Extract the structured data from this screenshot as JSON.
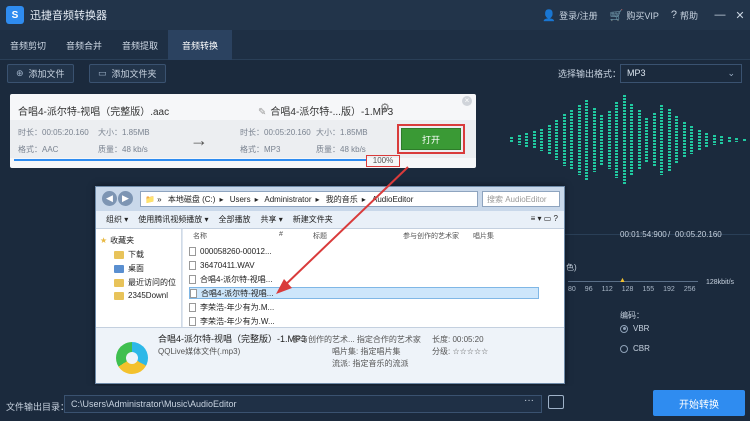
{
  "app": {
    "title": "迅捷音频转换器",
    "logo": "S"
  },
  "topbar": {
    "login": "登录/注册",
    "buy_vip": "购买VIP",
    "help": "帮助",
    "icons": [
      "user-icon",
      "cart-icon",
      "help-icon",
      "minimize-icon",
      "close-icon"
    ]
  },
  "tabs": [
    "音频剪切",
    "音频合并",
    "音频提取",
    "音频转换"
  ],
  "active_tab": "音频转换",
  "toolbar": {
    "add_file": "添加文件",
    "add_folder": "添加文件夹"
  },
  "format": {
    "label": "选择输出格式：",
    "value": "MP3"
  },
  "file": {
    "input_name": "合唱4-派尔特-视唱（完整版）.aac",
    "output_name": "合唱4-派尔特-...版）-1.MP3",
    "in_duration": "时长：00:05:20.160",
    "in_size": "大小：1.85MB",
    "in_format": "格式：AAC",
    "in_quality": "质量：48 kb/s",
    "out_duration": "时长：00:05:20.160",
    "out_size": "大小：1.85MB",
    "out_format": "格式：MP3",
    "out_quality": "质量：48 kb/s",
    "open_label": "打开",
    "progress_text": "100%",
    "progress": 1.0
  },
  "player": {
    "current": "00:01:54:900",
    "separator": "/",
    "total": "00:05.20.160"
  },
  "params": {
    "partial_label": "色)",
    "bitrates": [
      "80",
      "96",
      "112",
      "128",
      "155",
      "192",
      "256"
    ],
    "bitrate_unit": "128kbit/s",
    "encode_label": "编码：",
    "vbr": "VBR",
    "cbr": "CBR"
  },
  "explorer": {
    "path": [
      "本地磁盘 (C:)",
      "Users",
      "Administrator",
      "我的音乐",
      "AudioEditor"
    ],
    "search_placeholder": "搜索 AudioEditor",
    "commands": [
      "组织 ▾",
      "使用腾讯视频播放 ▾",
      "全部播放",
      "共享 ▾",
      "新建文件夹"
    ],
    "nav": [
      "收藏夹",
      "下载",
      "桌面",
      "最近访问的位",
      "2345Downl"
    ],
    "columns": [
      "名称",
      "#",
      "标题",
      "参与创作的艺术家",
      "唱片集"
    ],
    "files": [
      "000058260-00012...",
      "36470411.WAV",
      "合唱4-派尔特-视唱...",
      "合唱4-派尔特-视唱...",
      "李荣浩-年少有为.M...",
      "李荣浩-年少有为.W..."
    ],
    "selected_index": 3,
    "detail": {
      "name": "合唱4-派尔特-视唱（完整版）-1.MP3",
      "type": "QQLive媒体文件(.mp3)",
      "artist": "参与创作的艺术... 指定合作的艺术家",
      "album": "唱片集: 指定唱片集",
      "genre": "流派: 指定音乐的流派",
      "length": "长度: 00:05:20",
      "rating": "分级: ☆☆☆☆☆"
    }
  },
  "output": {
    "label": "文件输出目录：",
    "path": "C:\\Users\\Administrator\\Music\\AudioEditor",
    "more": "···"
  },
  "start_button": "开始转换",
  "colors": {
    "accent": "#2f8cf0",
    "open": "#3a9a35",
    "viz": "#20c9a0",
    "highlight": "#d93b3b"
  }
}
